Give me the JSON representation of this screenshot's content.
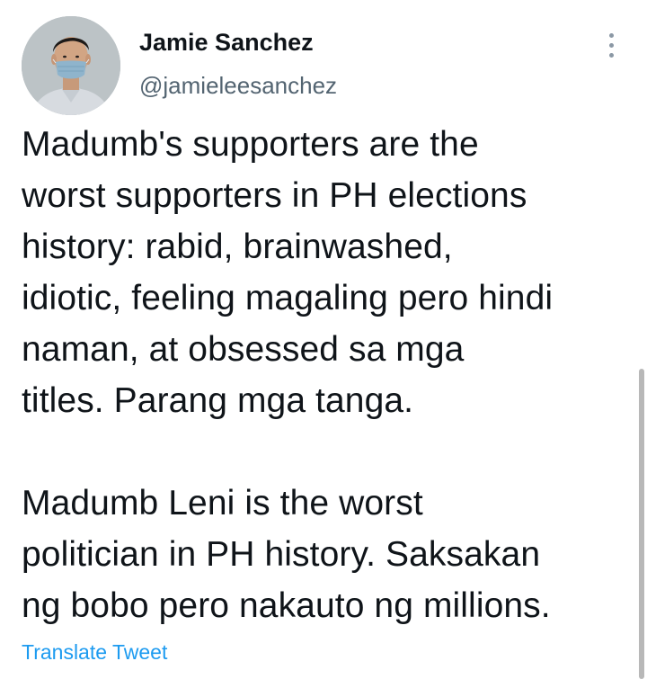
{
  "author": {
    "name": "Jamie Sanchez",
    "handle": "@jamieleesanchez"
  },
  "tweet": {
    "paragraph1": [
      "Madumb's supporters are the",
      "worst supporters in PH elections",
      "history: rabid, brainwashed,",
      "idiotic, feeling magaling pero hindi",
      "naman, at obsessed sa mga",
      "titles. Parang mga tanga."
    ],
    "paragraph2": [
      "Madumb Leni is the worst",
      "politician in PH history. Saksakan",
      "ng bobo pero nakauto ng millions."
    ]
  },
  "translate_label": "Translate Tweet",
  "colors": {
    "text": "#0f1419",
    "secondary": "#536471",
    "link": "#1d9bf0"
  },
  "icons": {
    "more": "more-vertical-icon"
  }
}
